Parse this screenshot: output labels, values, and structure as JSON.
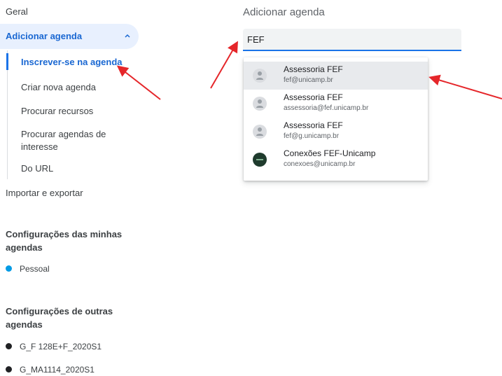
{
  "sidebar": {
    "general": "Geral",
    "add_calendar": {
      "label": "Adicionar agenda",
      "sub_items": [
        "Inscrever-se na agenda",
        "Criar nova agenda",
        "Procurar recursos",
        "Procurar agendas de interesse",
        "Do URL"
      ]
    },
    "import_export": "Importar e exportar",
    "my_calendars_settings": "Configurações das minhas agendas",
    "my_calendars": [
      {
        "name": "Pessoal",
        "color": "#039be5"
      }
    ],
    "other_calendars_settings": "Configurações de outras agendas",
    "other_calendars": [
      {
        "name": "G_F 128E+F_2020S1",
        "color": "#202124"
      },
      {
        "name": "G_MA1114_2020S1",
        "color": "#202124"
      }
    ]
  },
  "main": {
    "title": "Adicionar agenda",
    "search": {
      "value": "FEF",
      "placeholder": ""
    },
    "suggestions": [
      {
        "name": "Assessoria FEF",
        "email": "fef@unicamp.br"
      },
      {
        "name": "Assessoria FEF",
        "email": "assessoria@fef.unicamp.br"
      },
      {
        "name": "Assessoria FEF",
        "email": "fef@g.unicamp.br"
      },
      {
        "name": "Conexões FEF-Unicamp",
        "email": "conexoes@unicamp.br"
      }
    ]
  },
  "colors": {
    "accent": "#1a73e8",
    "annotation_arrow": "#e5262a"
  }
}
